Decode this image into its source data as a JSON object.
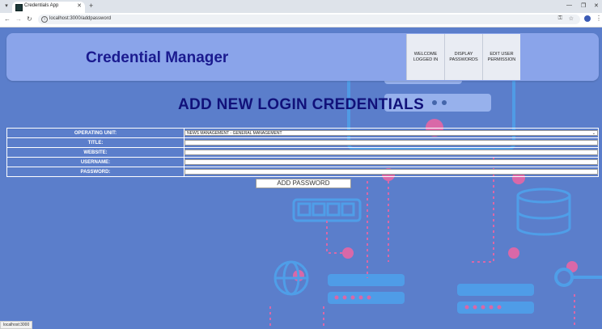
{
  "browser": {
    "tab_title": "Credentials App",
    "url": "localhost:3000/addpassword",
    "status_url": "localhost:3000"
  },
  "header": {
    "app_title": "Credential Manager",
    "nav": [
      {
        "label": "WELCOME LOGGED IN"
      },
      {
        "label": "DISPLAY PASSWORDS"
      },
      {
        "label": "EDIT USER PERMISSION"
      }
    ]
  },
  "page_heading": "ADD NEW LOGIN CREDENTIALS",
  "form": {
    "fields": [
      {
        "label": "OPERATING UNIT:",
        "value": "NEWS MANAGEMENT - GENERAL MANAGEMENT"
      },
      {
        "label": "TITLE:",
        "value": ""
      },
      {
        "label": "WEBSITE:",
        "value": ""
      },
      {
        "label": "USERNAME:",
        "value": ""
      },
      {
        "label": "PASSWORD:",
        "value": ""
      }
    ],
    "submit_label": "ADD PASSWORD"
  },
  "colors": {
    "background": "#5b7ecb",
    "header_bg": "#8aa4ea",
    "title_text": "#1a1a8f",
    "heading_text": "#11117a",
    "accent_icons": "#4f9ee8",
    "accent_pink": "#d968a8"
  }
}
